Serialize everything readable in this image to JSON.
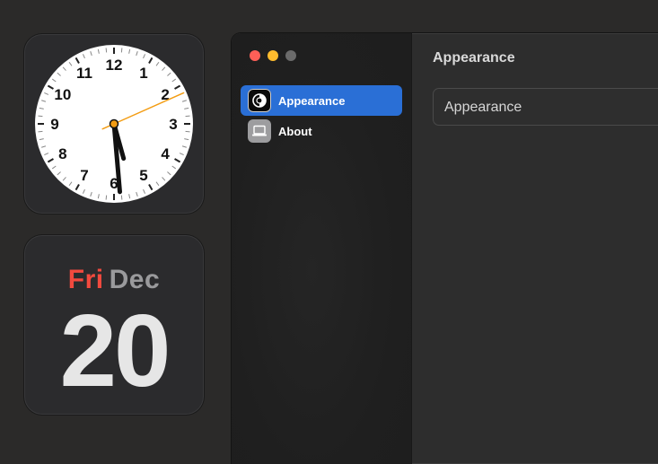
{
  "clock": {
    "numerals": [
      "12",
      "1",
      "2",
      "3",
      "4",
      "5",
      "6",
      "7",
      "8",
      "9",
      "10",
      "11"
    ],
    "hour": 5,
    "minute": 29,
    "second": 11
  },
  "calendar": {
    "day_of_week": "Fri",
    "month": "Dec",
    "date": "20"
  },
  "window": {
    "sidebar": {
      "items": [
        {
          "label": "Appearance",
          "icon": "appearance-icon",
          "selected": true
        },
        {
          "label": "About",
          "icon": "laptop-icon",
          "selected": false
        }
      ]
    },
    "content": {
      "title": "Appearance",
      "select_value": "Appearance"
    }
  },
  "colors": {
    "selection": "#2a6fd6",
    "calendar_day": "#f24a3e",
    "clock_second_hand": "#f39c12",
    "traffic_close": "#fe5f57",
    "traffic_minimize": "#febc2e"
  }
}
